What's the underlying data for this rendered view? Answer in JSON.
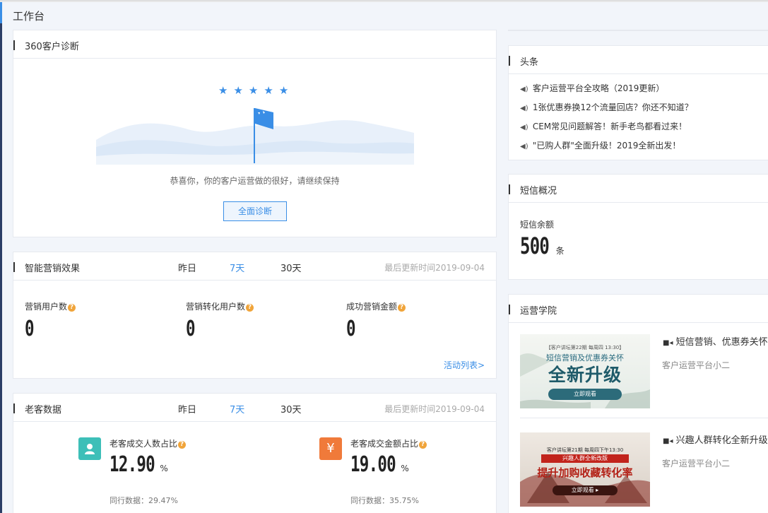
{
  "page": {
    "title": "工作台"
  },
  "diagnosis": {
    "title": "360客户诊断",
    "message": "恭喜你，你的客户运营做的很好，请继续保持",
    "button": "全面诊断",
    "stars": 5
  },
  "marketing": {
    "title": "智能营销效果",
    "ranges": [
      "昨日",
      "7天",
      "30天"
    ],
    "active_range": "7天",
    "updated": "最后更新时间2019-09-04",
    "metrics": [
      {
        "label": "营销用户数",
        "value": "0"
      },
      {
        "label": "营销转化用户数",
        "value": "0"
      },
      {
        "label": "成功营销金额",
        "value": "0"
      }
    ],
    "activity_link": "活动列表>"
  },
  "returning": {
    "title": "老客数据",
    "ranges": [
      "昨日",
      "7天",
      "30天"
    ],
    "active_range": "7天",
    "updated": "最后更新时间2019-09-04",
    "kpis": [
      {
        "label": "老客成交人数占比",
        "value": "12.90",
        "unit": "%",
        "peer": "同行数据：29.47%",
        "icon": "user-icon",
        "color": "#3dbfb8"
      },
      {
        "label": "老客成交金额占比",
        "value": "19.00",
        "unit": "%",
        "peer": "同行数据：35.75%",
        "icon": "yen-icon",
        "color": "#f07a3a",
        "glyph": "¥"
      }
    ]
  },
  "headlines": {
    "title": "头条",
    "items": [
      "客户运营平台全攻略（2019更新）",
      "1张优惠券换12个流量回店？你还不知道？",
      "CEM常见问题解答！新手老鸟都看过来！",
      "\"已购人群\"全面升级！2019全新出发！"
    ]
  },
  "sms": {
    "title": "短信概况",
    "balance_label": "短信余额",
    "balance": "500",
    "unit": "条"
  },
  "academy": {
    "title": "运营学院",
    "courses": [
      {
        "title": "短信营销、优惠券关怀",
        "author": "客户运营平台小二",
        "thumb_top": "【客户讲坛第22期 每周四 13:30】",
        "thumb_sub": "短信营销及优惠券关怀",
        "thumb_main": "全新升级",
        "thumb_btn": "立即观看"
      },
      {
        "title": "兴趣人群转化全新升级",
        "author": "客户运营平台小二",
        "thumb_top": "客户讲坛第21期 每周四下午13:30",
        "thumb_sub": "兴趣人群全新改版",
        "thumb_main": "提升加购收藏转化率",
        "thumb_btn": "立即观看 ▸"
      }
    ]
  },
  "colors": {
    "accent": "#3a8ee6",
    "help": "#f0a43a"
  }
}
